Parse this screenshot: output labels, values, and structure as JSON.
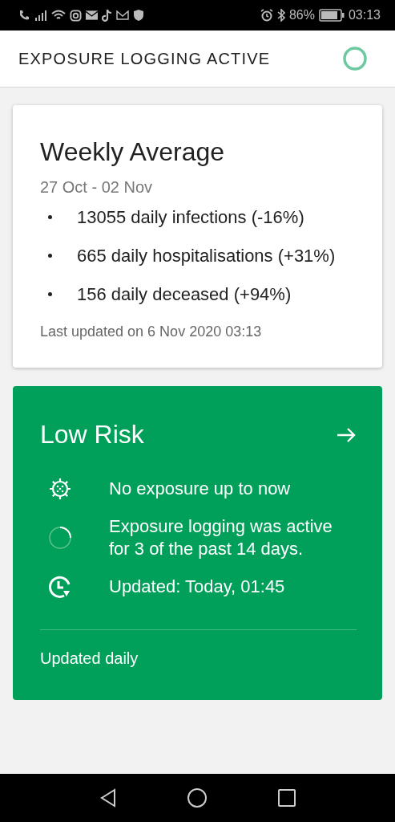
{
  "status_bar": {
    "battery": "86%",
    "time": "03:13"
  },
  "header": {
    "title": "EXPOSURE LOGGING ACTIVE"
  },
  "weekly_card": {
    "title": "Weekly Average",
    "date_range": "27 Oct - 02 Nov",
    "items": [
      "13055 daily infections (-16%)",
      "665 daily hospitalisations (+31%)",
      "156 daily deceased (+94%)"
    ],
    "updated": "Last updated on 6 Nov 2020 03:13"
  },
  "risk_card": {
    "title": "Low Risk",
    "items": [
      {
        "kind": "virus",
        "text": "No exposure up to now"
      },
      {
        "kind": "ring",
        "text": "Exposure logging was active for 3 of the past 14 days."
      },
      {
        "kind": "clock",
        "text": "Updated: Today, 01:45"
      }
    ],
    "footer": "Updated daily"
  }
}
